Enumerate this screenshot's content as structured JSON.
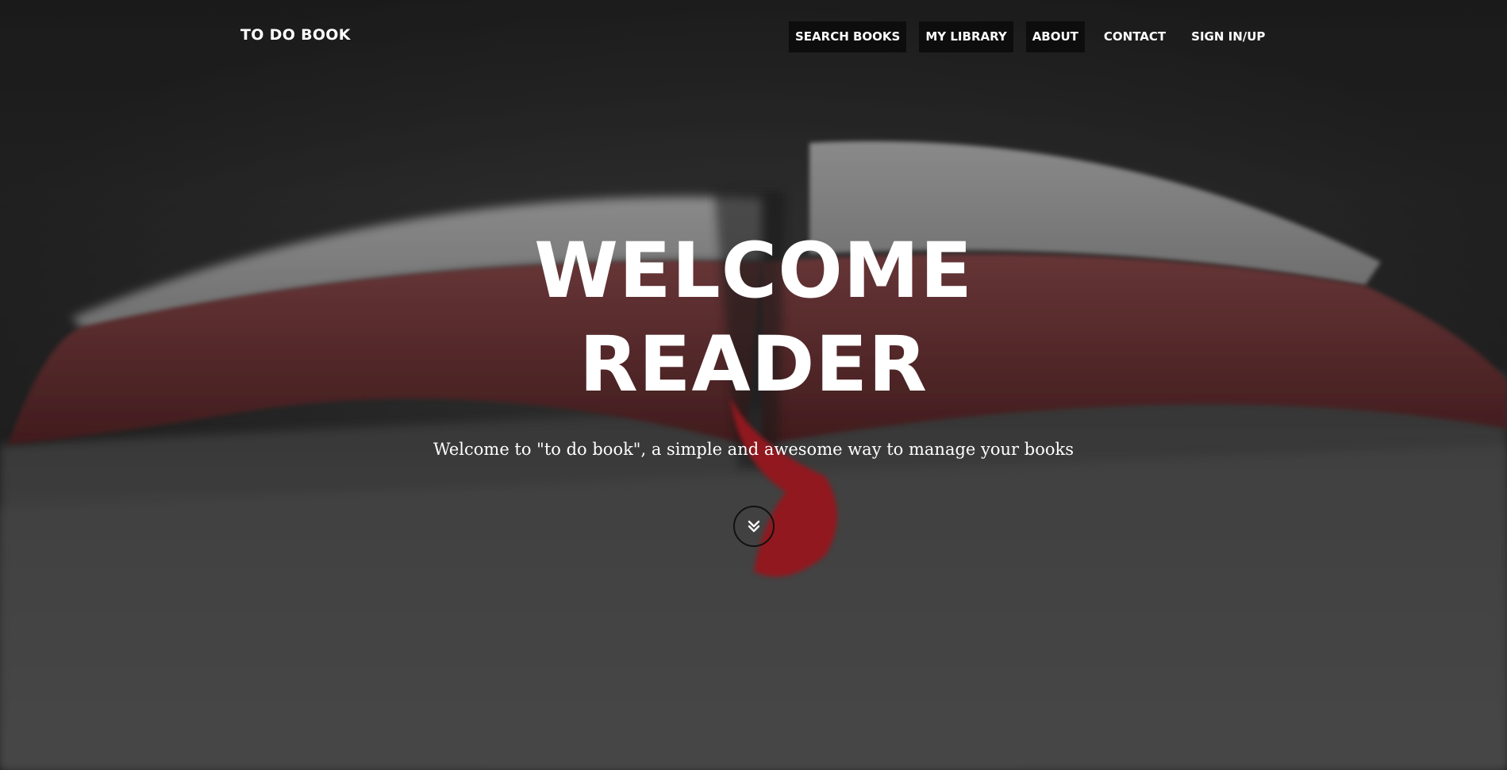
{
  "navbar": {
    "brand": "TO DO BOOK",
    "items": [
      {
        "label": "SEARCH BOOKS",
        "highlighted": true
      },
      {
        "label": "MY LIBRARY",
        "highlighted": true
      },
      {
        "label": "ABOUT",
        "highlighted": true
      },
      {
        "label": "CONTACT",
        "highlighted": false
      },
      {
        "label": "SIGN IN/UP",
        "highlighted": false
      }
    ]
  },
  "hero": {
    "title_line1": "WELCOME",
    "title_line2": "READER",
    "subtitle": "Welcome to \"to do book\", a simple and awesome way to manage your books",
    "scroll_icon": "double-chevron-down-icon",
    "background_image": "open-book-photo"
  },
  "colors": {
    "text": "#ffffff",
    "nav_active_bg": "#0d0d0d",
    "ribbon": "#c8212b",
    "page_edge": "#7a3a3c"
  }
}
